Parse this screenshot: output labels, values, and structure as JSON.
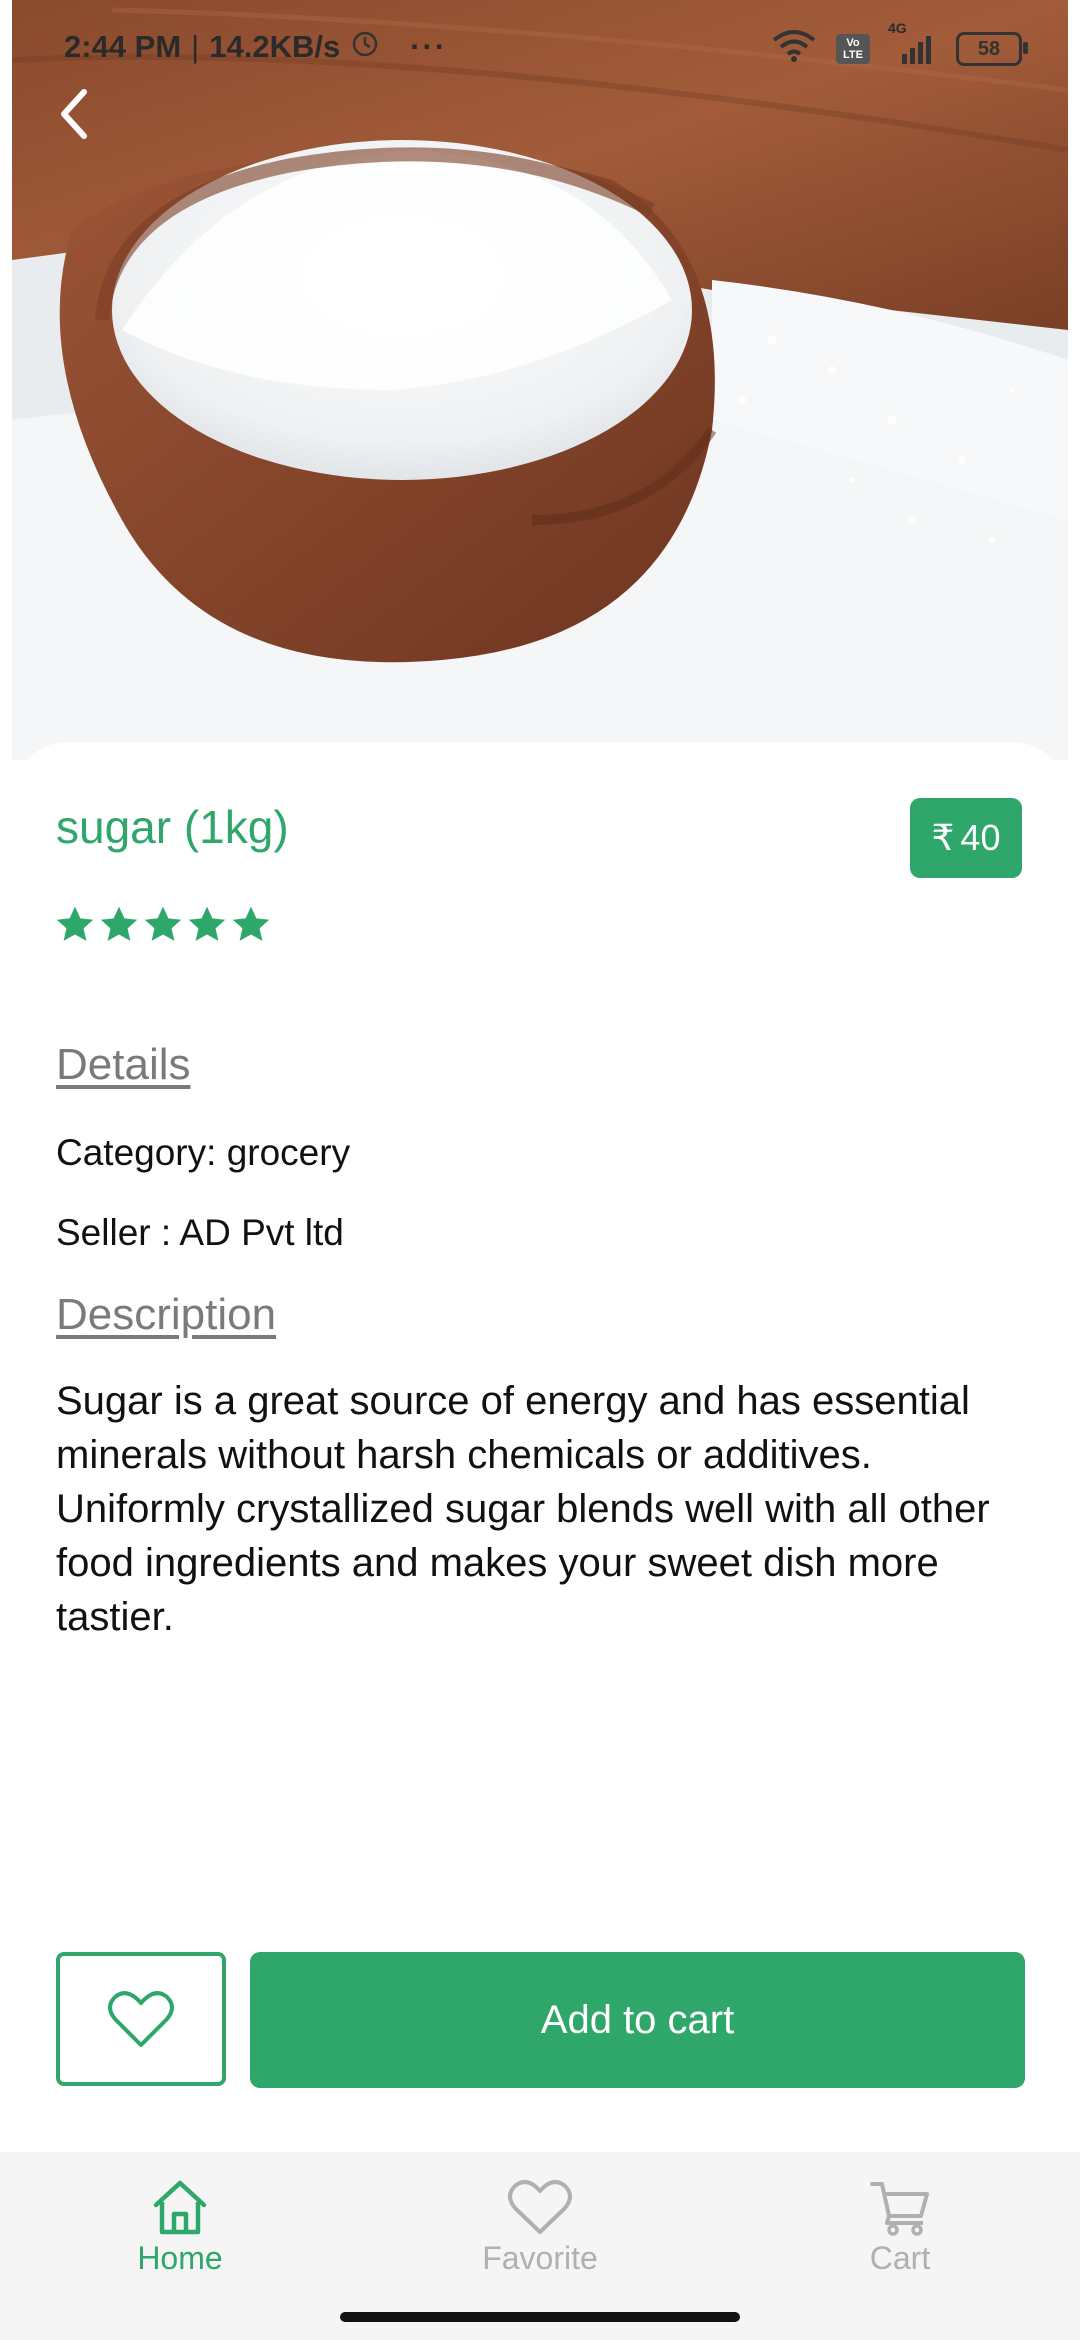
{
  "status_bar": {
    "time": "2:44 PM",
    "separator": "|",
    "net_speed": "14.2KB/s",
    "more": "···",
    "network": "4G",
    "volte": "Vo LTE",
    "battery": "58"
  },
  "product": {
    "title": "sugar (1kg)",
    "currency_symbol": "₹",
    "price": "40",
    "rating_stars": 5,
    "rating_max": 5
  },
  "details": {
    "heading": "Details",
    "category": "Category: grocery",
    "seller": "Seller : AD Pvt ltd"
  },
  "description": {
    "heading": "Description",
    "text": "Sugar is a great source of energy and has essential minerals without harsh chemicals or additives. Uniformly crystallized sugar blends well with all other food ingredients and makes your sweet dish more tastier."
  },
  "actions": {
    "favorite_icon": "heart-outline-icon",
    "add_to_cart_label": "Add to cart"
  },
  "bottom_nav": {
    "items": [
      {
        "label": "Home",
        "icon": "home-icon",
        "active": true
      },
      {
        "label": "Favorite",
        "icon": "heart-icon",
        "active": false
      },
      {
        "label": "Cart",
        "icon": "cart-icon",
        "active": false
      }
    ]
  },
  "colors": {
    "accent": "#2fa76a",
    "muted": "#b0b0b0",
    "section_heading": "#7a7a7a"
  }
}
